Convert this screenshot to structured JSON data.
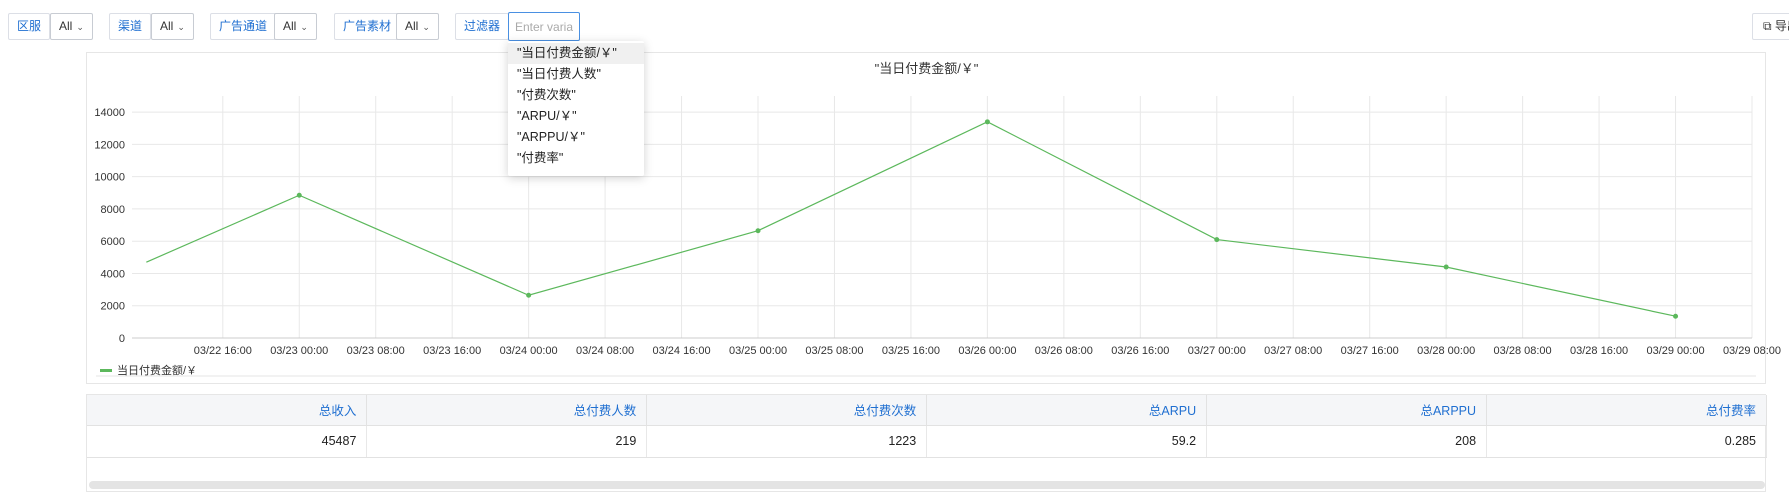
{
  "filters": [
    {
      "label": "区服",
      "value": "All"
    },
    {
      "label": "渠道",
      "value": "All"
    },
    {
      "label": "广告通道",
      "value": "All"
    },
    {
      "label": "广告素材",
      "value": "All"
    }
  ],
  "filter_box": {
    "label": "过滤器",
    "placeholder": "Enter variable name"
  },
  "export_label": "导出",
  "dropdown": {
    "items": [
      "\"当日付费金额/￥\"",
      "\"当日付费人数\"",
      "\"付费次数\"",
      "\"ARPU/￥\"",
      "\"ARPPU/￥\"",
      "\"付费率\""
    ],
    "active_index": 0
  },
  "chart_data": {
    "type": "line",
    "title": "\"当日付费金额/￥\"",
    "x_tick_labels": [
      "03/22 16:00",
      "03/23 00:00",
      "03/23 08:00",
      "03/23 16:00",
      "03/24 00:00",
      "03/24 08:00",
      "03/24 16:00",
      "03/25 00:00",
      "03/25 08:00",
      "03/25 16:00",
      "03/26 00:00",
      "03/26 08:00",
      "03/26 16:00",
      "03/27 00:00",
      "03/27 08:00",
      "03/27 16:00",
      "03/28 00:00",
      "03/28 08:00",
      "03/28 16:00",
      "03/29 00:00",
      "03/29 08:00"
    ],
    "y_ticks": [
      0,
      2000,
      4000,
      6000,
      8000,
      10000,
      12000,
      14000
    ],
    "ylim": [
      0,
      15000
    ],
    "xlim": [
      "03/22 06:30",
      "03/29 08:00"
    ],
    "series": [
      {
        "name": "当日付费金额/￥",
        "color": "#5cb85c",
        "points": [
          {
            "x": "03/22 08:00",
            "y": 4700
          },
          {
            "x": "03/23 00:00",
            "y": 8850
          },
          {
            "x": "03/24 00:00",
            "y": 2650
          },
          {
            "x": "03/25 00:00",
            "y": 6650
          },
          {
            "x": "03/26 00:00",
            "y": 13400
          },
          {
            "x": "03/27 00:00",
            "y": 6100
          },
          {
            "x": "03/28 00:00",
            "y": 4400
          },
          {
            "x": "03/29 00:00",
            "y": 1350
          }
        ]
      }
    ],
    "grid": true,
    "legend_position": "bottom-left"
  },
  "summary": {
    "headers": [
      "总收入",
      "总付费人数",
      "总付费次数",
      "总ARPU",
      "总ARPPU",
      "总付费率"
    ],
    "values": [
      "45487",
      "219",
      "1223",
      "59.2",
      "208",
      "0.285"
    ]
  },
  "colors": {
    "accent": "#1f6fd1",
    "series": "#5cb85c"
  }
}
